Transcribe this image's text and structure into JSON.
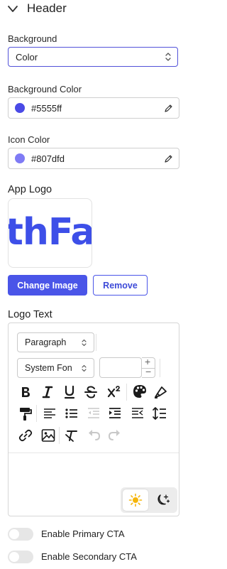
{
  "header": {
    "title": "Header"
  },
  "background": {
    "label": "Background",
    "value": "Color"
  },
  "background_color": {
    "label": "Background Color",
    "value": "#5555ff",
    "swatch": "#5555ff"
  },
  "icon_color": {
    "label": "Icon Color",
    "value": "#807dfd",
    "swatch": "#807dfd"
  },
  "app_logo": {
    "label": "App Logo",
    "logo_text": "thFa",
    "change_button": "Change Image",
    "remove_button": "Remove"
  },
  "logo_text_editor": {
    "label": "Logo Text",
    "block_format": "Paragraph",
    "font_family": "System Fon",
    "font_size": "",
    "stepper_plus": "+",
    "stepper_minus": "−",
    "toolbar": [
      "bold-icon",
      "italic-icon",
      "underline-icon",
      "strikethrough-icon",
      "superscript-icon",
      "palette-icon",
      "highlight-icon",
      "paint-roller-icon",
      "align-left-icon",
      "bullet-list-icon",
      "outdent-icon",
      "indent-icon",
      "rtl-indent-icon",
      "line-height-icon",
      "link-icon",
      "image-icon",
      "clear-format-icon",
      "undo-icon",
      "redo-icon",
      "sun-icon",
      "moon-icon"
    ]
  },
  "toggles": {
    "primary_cta": {
      "label": "Enable Primary CTA",
      "on": false
    },
    "secondary_cta": {
      "label": "Enable Secondary CTA",
      "on": false
    }
  }
}
